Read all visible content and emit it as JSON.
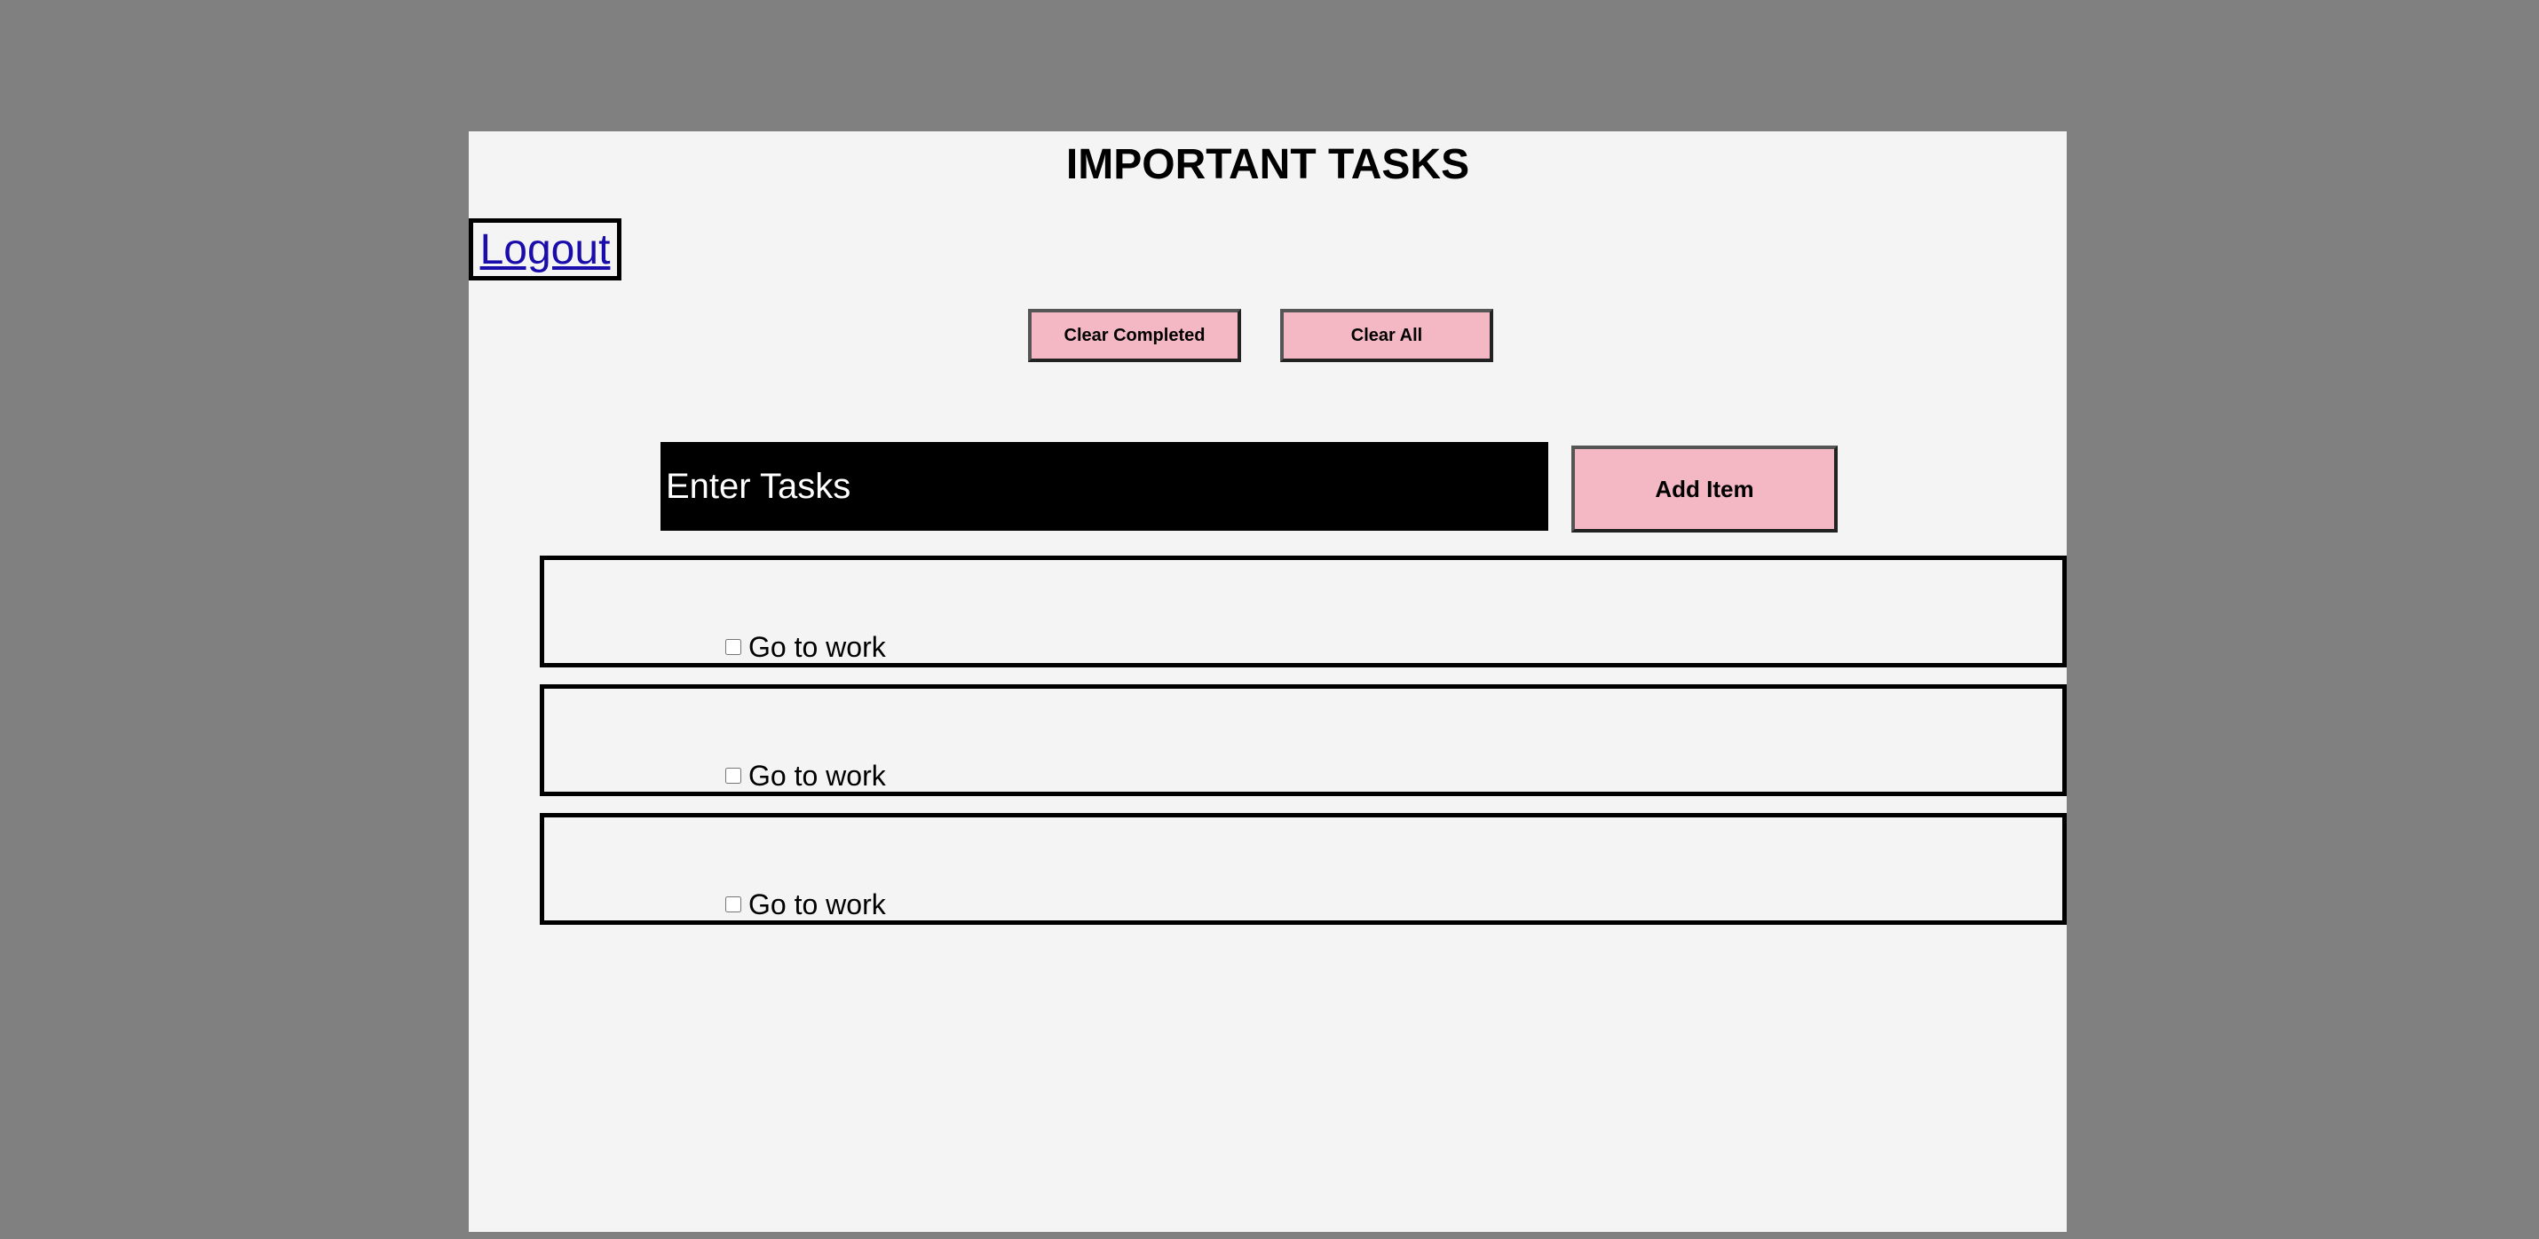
{
  "header": {
    "title": "IMPORTANT TASKS"
  },
  "nav": {
    "logout_label": "Logout"
  },
  "controls": {
    "clear_completed_label": "Clear Completed",
    "clear_all_label": "Clear All"
  },
  "entry": {
    "placeholder": "Enter Tasks",
    "value": "",
    "add_label": "Add Item"
  },
  "tasks": [
    {
      "text": "Go to work",
      "completed": false
    },
    {
      "text": "Go to work",
      "completed": false
    },
    {
      "text": "Go to work",
      "completed": false
    }
  ],
  "colors": {
    "backdrop": "#808080",
    "page": "#f4f4f4",
    "button": "#f4b8c4",
    "input_bg": "#000000",
    "link": "#1a0dab"
  }
}
